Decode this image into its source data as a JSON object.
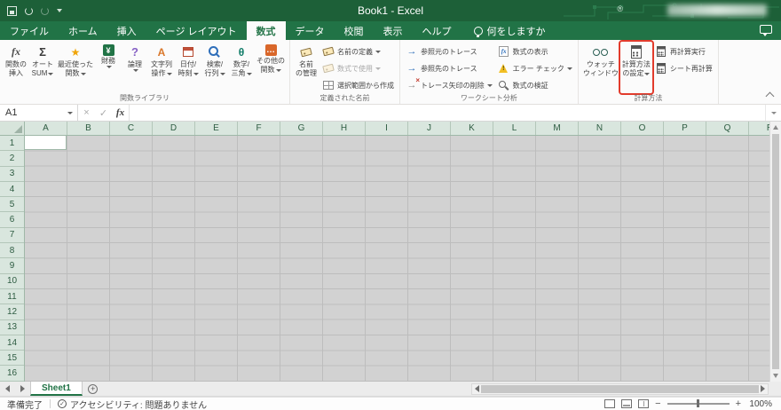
{
  "title_bar": {
    "title": "Book1 - Excel",
    "registered_mark": "®"
  },
  "ribbon_tabs": {
    "items": [
      {
        "label": "ファイル"
      },
      {
        "label": "ホーム"
      },
      {
        "label": "挿入"
      },
      {
        "label": "ページ レイアウト"
      },
      {
        "label": "数式",
        "active": true
      },
      {
        "label": "データ"
      },
      {
        "label": "校閲"
      },
      {
        "label": "表示"
      },
      {
        "label": "ヘルプ"
      }
    ],
    "tell_me": "何をしますか"
  },
  "ribbon": {
    "groups": [
      {
        "label": "関数ライブラリ",
        "buttons": [
          {
            "label1": "関数の",
            "label2": "挿入",
            "icon": "insert-function-icon",
            "caret": false
          },
          {
            "label1": "オート",
            "label2": "SUM",
            "icon": "autosum-icon",
            "caret": true
          },
          {
            "label1": "最近使った",
            "label2": "関数",
            "icon": "recently-used-icon",
            "caret": true
          },
          {
            "label1": "財務",
            "label2": "",
            "icon": "financial-icon",
            "caret": true
          },
          {
            "label1": "論理",
            "label2": "",
            "icon": "logical-icon",
            "caret": true
          },
          {
            "label1": "文字列",
            "label2": "操作",
            "icon": "text-icon",
            "caret": true
          },
          {
            "label1": "日付/",
            "label2": "時刻",
            "icon": "date-time-icon",
            "caret": true
          },
          {
            "label1": "検索/",
            "label2": "行列",
            "icon": "lookup-reference-icon",
            "caret": true
          },
          {
            "label1": "数学/",
            "label2": "三角",
            "icon": "math-trig-icon",
            "caret": true
          },
          {
            "label1": "その他の",
            "label2": "関数",
            "icon": "more-functions-icon",
            "caret": true
          }
        ]
      },
      {
        "label": "定義された名前",
        "name_manager": {
          "label1": "名前",
          "label2": "の管理",
          "icon": "name-manager-icon"
        },
        "small": [
          {
            "label": "名前の定義",
            "icon": "define-name-icon",
            "caret": true,
            "disabled": false
          },
          {
            "label": "数式で使用",
            "icon": "use-in-formula-icon",
            "caret": true,
            "disabled": true
          },
          {
            "label": "選択範囲から作成",
            "icon": "create-from-selection-icon",
            "caret": false,
            "disabled": false
          }
        ]
      },
      {
        "label": "ワークシート分析",
        "col1": [
          {
            "label": "参照元のトレース",
            "icon": "trace-precedents-icon",
            "caret": false
          },
          {
            "label": "参照先のトレース",
            "icon": "trace-dependents-icon",
            "caret": false
          },
          {
            "label": "トレース矢印の削除",
            "icon": "remove-arrows-icon",
            "caret": true
          }
        ],
        "col2": [
          {
            "label": "数式の表示",
            "icon": "show-formulas-icon",
            "caret": false
          },
          {
            "label": "エラー チェック",
            "icon": "error-checking-icon",
            "caret": true
          },
          {
            "label": "数式の検証",
            "icon": "evaluate-formula-icon",
            "caret": false
          }
        ]
      },
      {
        "label": "計算方法",
        "watch_window": {
          "label1": "ウォッチ",
          "label2": "ウィンドウ",
          "icon": "watch-window-icon"
        },
        "calculation_options": {
          "label1": "計算方法",
          "label2": "の設定",
          "icon": "calculation-options-icon",
          "highlighted": true
        },
        "small": [
          {
            "label": "再計算実行",
            "icon": "calculate-now-icon"
          },
          {
            "label": "シート再計算",
            "icon": "calculate-sheet-icon"
          }
        ]
      }
    ]
  },
  "formula_bar": {
    "name_box": "A1",
    "cancel_glyph": "×",
    "enter_glyph": "✓",
    "fx_label": "fx",
    "formula": ""
  },
  "grid": {
    "columns": [
      "A",
      "B",
      "C",
      "D",
      "E",
      "F",
      "G",
      "H",
      "I",
      "J",
      "K",
      "L",
      "M",
      "N",
      "O",
      "P",
      "Q",
      "R"
    ],
    "rows": [
      "1",
      "2",
      "3",
      "4",
      "5",
      "6",
      "7",
      "8",
      "9",
      "10",
      "11",
      "12",
      "13",
      "14",
      "15",
      "16"
    ],
    "active_cell": "A1"
  },
  "sheet_bar": {
    "tabs": [
      {
        "label": "Sheet1",
        "active": true
      }
    ]
  },
  "status_bar": {
    "ready": "準備完了",
    "accessibility": "アクセシビリティ: 問題ありません",
    "zoom_out": "−",
    "zoom_in": "+",
    "zoom_level": "100%"
  }
}
